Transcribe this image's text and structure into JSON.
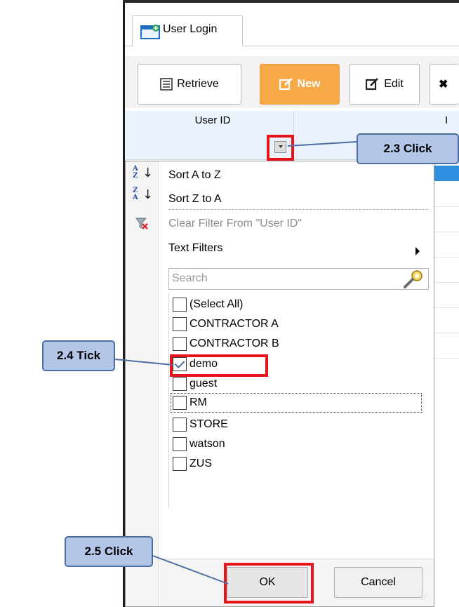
{
  "tab": {
    "label": "User Login"
  },
  "toolbar": {
    "retrieve_label": "Retrieve",
    "new_label": "New",
    "edit_label": "Edit",
    "more_glyph": "✖"
  },
  "grid": {
    "columns": [
      "User ID",
      "I"
    ]
  },
  "filter_menu": {
    "sort_az": "Sort A to Z",
    "sort_za": "Sort Z to A",
    "clear_filter": "Clear Filter From \"User ID\"",
    "text_filters": "Text Filters",
    "search_placeholder": "Search",
    "items": [
      {
        "label": "(Select All)",
        "checked": false
      },
      {
        "label": "CONTRACTOR A",
        "checked": false
      },
      {
        "label": "CONTRACTOR B",
        "checked": false
      },
      {
        "label": "demo",
        "checked": true
      },
      {
        "label": "guest",
        "checked": false
      },
      {
        "label": "RM",
        "checked": false
      },
      {
        "label": "STORE",
        "checked": false
      },
      {
        "label": "watson",
        "checked": false
      },
      {
        "label": "ZUS",
        "checked": false
      }
    ],
    "ok_label": "OK",
    "cancel_label": "Cancel"
  },
  "annotations": {
    "step_23": "2.3 Click",
    "step_24": "2.4 Tick",
    "step_25": "2.5 Click"
  },
  "colors": {
    "new_button": "#f7a847",
    "highlight": "#e8141b",
    "callout_fill": "#b4c6e7",
    "callout_border": "#4d6ea3",
    "header_bg": "#eaf3fb",
    "selected_row": "#2f8fde"
  }
}
